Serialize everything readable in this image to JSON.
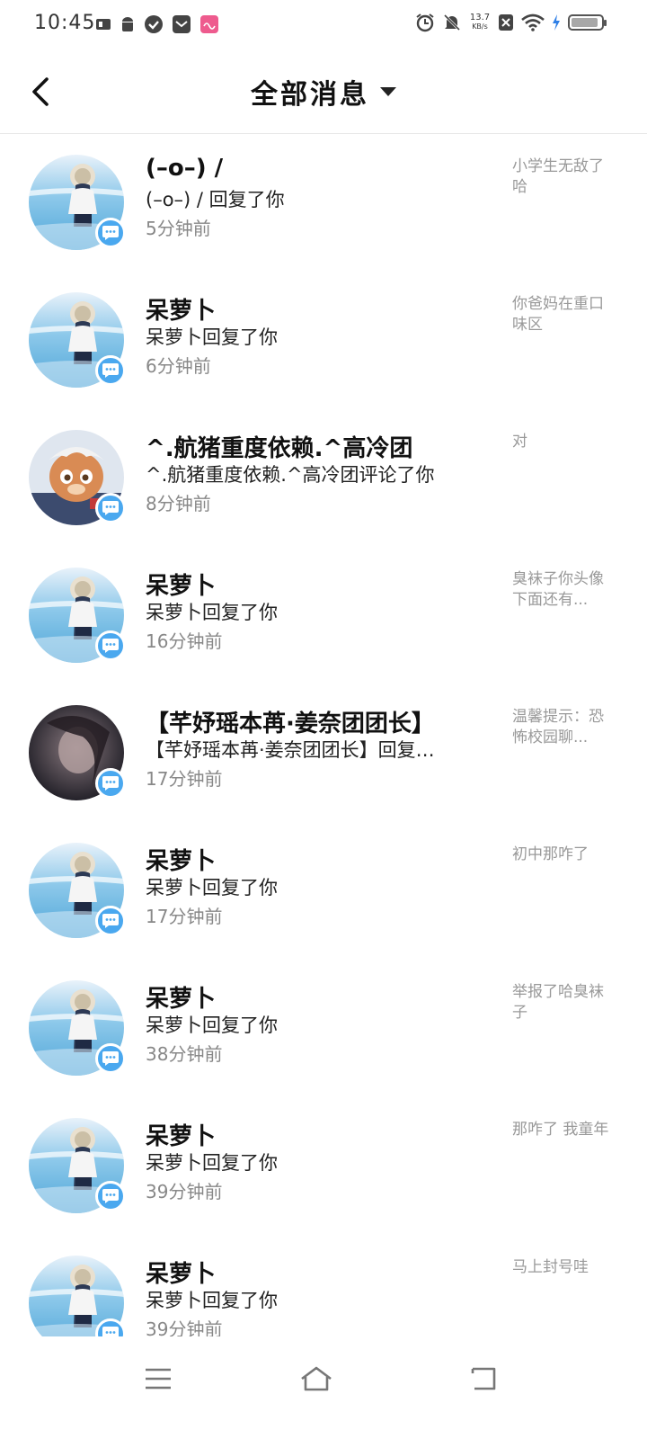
{
  "status_bar": {
    "time": "10:45",
    "net_speed_value": "13.7",
    "net_speed_unit": "KB/s",
    "icons_left": [
      "sim-icon",
      "android-icon",
      "check-icon",
      "mail-icon",
      "app-badge-icon"
    ],
    "icons_right": [
      "alarm-icon",
      "mute-icon",
      "net-speed",
      "sim-x-icon",
      "wifi-icon",
      "charging-icon",
      "battery-icon"
    ],
    "battery_level": 0.9
  },
  "header": {
    "back_icon": "chevron-left-icon",
    "title": "全部消息",
    "dropdown_icon": "caret-down-icon"
  },
  "colors": {
    "badge": "#4aa8ef",
    "time_text": "#888888",
    "quote_text": "#999999",
    "divider": "#e8e8e8"
  },
  "messages": [
    {
      "name": "(–o–) /",
      "action": "(–o–) / 回复了你",
      "time": "5分钟前",
      "quote": "小学生无敌了哈",
      "avatar": "girl-photo-avatar"
    },
    {
      "name": "呆萝卜",
      "action": "呆萝卜回复了你",
      "time": "6分钟前",
      "quote": "你爸妈在重口味区",
      "avatar": "girl-photo-avatar"
    },
    {
      "name": "^.航猪重度依赖.^高冷团",
      "action": "^.航猪重度依赖.^高冷团评论了你",
      "time": "8分钟前",
      "quote": "对",
      "avatar": "cartoon-character-avatar"
    },
    {
      "name": "呆萝卜",
      "action": "呆萝卜回复了你",
      "time": "16分钟前",
      "quote": "臭袜子你头像下面还有...",
      "avatar": "girl-photo-avatar"
    },
    {
      "name": "【芊妤瑶本苒·姜奈团团长】",
      "action": "【芊妤瑶本苒·姜奈团团长】回复…",
      "time": "17分钟前",
      "quote": "温馨提示：恐怖校园聊...",
      "avatar": "dark-portrait-avatar"
    },
    {
      "name": "呆萝卜",
      "action": "呆萝卜回复了你",
      "time": "17分钟前",
      "quote": "初中那咋了",
      "avatar": "girl-photo-avatar"
    },
    {
      "name": "呆萝卜",
      "action": "呆萝卜回复了你",
      "time": "38分钟前",
      "quote": "举报了哈臭袜子",
      "avatar": "girl-photo-avatar"
    },
    {
      "name": "呆萝卜",
      "action": "呆萝卜回复了你",
      "time": "39分钟前",
      "quote": "那咋了  我童年",
      "avatar": "girl-photo-avatar"
    },
    {
      "name": "呆萝卜",
      "action": "呆萝卜回复了你",
      "time": "39分钟前",
      "quote": "马上封号哇",
      "avatar": "girl-photo-avatar"
    }
  ],
  "nav_bar": {
    "menu_icon": "menu-icon",
    "home_icon": "home-icon",
    "back_icon": "back-icon"
  }
}
